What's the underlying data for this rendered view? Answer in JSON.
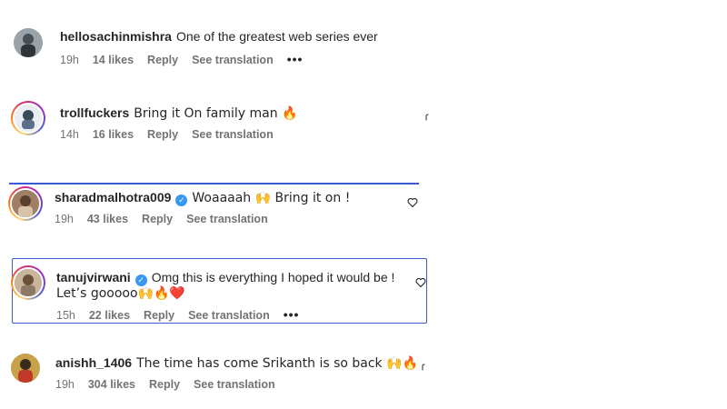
{
  "comments": [
    {
      "username": "hellosachinmishra",
      "text": "One of the greatest web series ever",
      "time": "19h",
      "likes": "14 likes",
      "reply": "Reply",
      "translate": "See translation",
      "more": "•••"
    },
    {
      "username": "trollfuckers",
      "text": "Bring it On family man 🔥",
      "time": "14h",
      "likes": "16 likes",
      "reply": "Reply",
      "translate": "See translation"
    },
    {
      "username": "sharadmalhotra009",
      "text": "Woaaaah 🙌 Bring it on !",
      "time": "19h",
      "likes": "43 likes",
      "reply": "Reply",
      "translate": "See translation"
    },
    {
      "username": "tanujvirwani",
      "text_line1": "Omg this is everything I hoped it would be !",
      "text_line2": "Let’s gooooo🙌🔥❤️",
      "time": "15h",
      "likes": "22 likes",
      "reply": "Reply",
      "translate": "See translation",
      "more": "•••"
    },
    {
      "username": "anishh_1406",
      "text": "The time has come Srikanth is so back 🙌🔥",
      "time": "19h",
      "likes": "304 likes",
      "reply": "Reply",
      "translate": "See translation"
    }
  ],
  "icons": {
    "verified": "verified-badge-icon",
    "like": "heart-icon"
  },
  "colors": {
    "highlight_border": "#3b5ad6",
    "verified_blue": "#3897f0",
    "meta_grey": "#737373"
  }
}
